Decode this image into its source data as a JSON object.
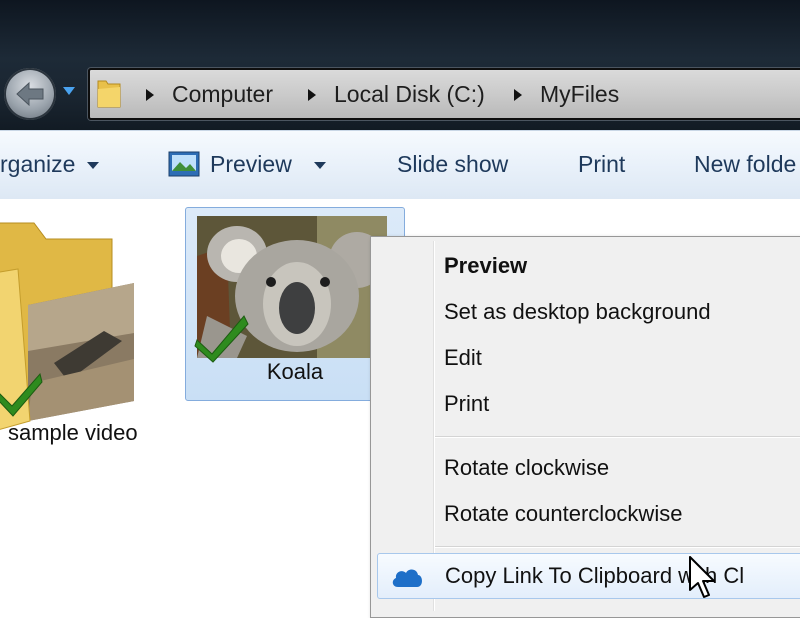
{
  "address": {
    "crumbs": [
      "Computer",
      "Local Disk (C:)",
      "MyFiles"
    ]
  },
  "toolbar": {
    "organize": "rganize",
    "preview": "Preview",
    "slideshow": "Slide show",
    "print": "Print",
    "new_folder": "New folde"
  },
  "files": {
    "folder_label": "sample video",
    "koala_label": "Koala"
  },
  "context_menu": {
    "items": [
      {
        "label": "Preview",
        "bold": true
      },
      {
        "label": "Set as desktop background"
      },
      {
        "label": "Edit"
      },
      {
        "label": "Print"
      },
      {
        "label": "Rotate clockwise"
      },
      {
        "label": "Rotate counterclockwise"
      },
      {
        "label": "Copy Link To Clipboard with Cl",
        "icon": "cloud-icon",
        "highlighted": true
      }
    ]
  },
  "icons": {
    "back": "back-arrow-icon",
    "history": "dropdown-arrow-icon",
    "folder": "folder-icon",
    "preview": "preview-icon",
    "sync": "green-check-icon",
    "cloud": "cloud-icon"
  },
  "colors": {
    "toolbar_text": "#1e395b",
    "selection": "#cde3f8",
    "check_green": "#2e8b1e",
    "cloud_blue": "#1e6fc8"
  }
}
